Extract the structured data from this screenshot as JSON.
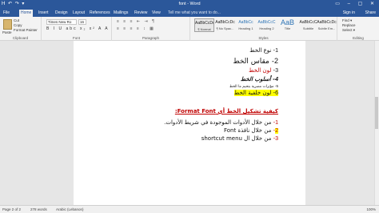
{
  "window": {
    "title": "font - Word",
    "qat": "H ↶ ↷ ▾",
    "controls": "▭ – ▢ ✕"
  },
  "tabs": [
    "File",
    "Home",
    "Insert",
    "Design",
    "Layout",
    "References",
    "Mailings",
    "Review",
    "View"
  ],
  "active_tab": "Home",
  "tell_me": "Tell me what you want to do...",
  "sign_in": "Sign in",
  "share": "Share",
  "ribbon": {
    "clipboard": {
      "paste": "Paste",
      "cut": "Cut",
      "copy": "Copy",
      "format_painter": "Format Painter",
      "label": "Clipboard"
    },
    "font": {
      "name": "Times New Ro",
      "size": "16",
      "format_row": "B I U abc x₂ x² A A",
      "label": "Font"
    },
    "paragraph": {
      "row1": "≡ ≡ ≡ ⇤ ⇥ ¶",
      "row2": "≡ ≡ ≡ ≡ ↕ ▦",
      "label": "Paragraph"
    },
    "styles": {
      "items": [
        {
          "preview": "AaBbCcDc",
          "name": "¶ Normal"
        },
        {
          "preview": "AaBbCcDc",
          "name": "¶ No Spac..."
        },
        {
          "preview": "AaBbCc",
          "name": "Heading 1"
        },
        {
          "preview": "AaBbCcC",
          "name": "Heading 2"
        },
        {
          "preview": "AaB",
          "name": "Title"
        },
        {
          "preview": "AaBbCcC",
          "name": "Subtitle"
        },
        {
          "preview": "AaBbCcDc",
          "name": "Subtle Em..."
        }
      ],
      "label": "Styles"
    },
    "editing": {
      "find": "Find ▾",
      "replace": "Replace",
      "select": "Select ▾",
      "label": "Editing"
    }
  },
  "document": {
    "lines": [
      {
        "num": "1",
        "text": "نوع الخط"
      },
      {
        "num": "2",
        "text": "مقاس الخط"
      },
      {
        "num": "3",
        "text": "لون الخط"
      },
      {
        "num": "4",
        "text": "أسلوب الخط"
      },
      {
        "num": "5",
        "text": "مؤثرات مضرية بتحيم ما الخط"
      },
      {
        "num": "6",
        "text": "لون خلفية الخط"
      }
    ],
    "heading": "كيفية تشكيل الخط أي Format Font:",
    "steps": [
      {
        "num": "1",
        "text": "من خلال الأدوات الموجودة في شريط الأدوات."
      },
      {
        "num": "2",
        "text": "من خلال نافذة Font"
      },
      {
        "num": "3",
        "text": "من خلال ال shortcut menu"
      }
    ]
  },
  "status": {
    "page": "Page 2 of 2",
    "words": "278 words",
    "language": "Arabic (Lebanon)",
    "zoom": "100%"
  },
  "colors": {
    "word_blue": "#2b579a",
    "red": "#c00000",
    "highlight": "#ffff00"
  }
}
